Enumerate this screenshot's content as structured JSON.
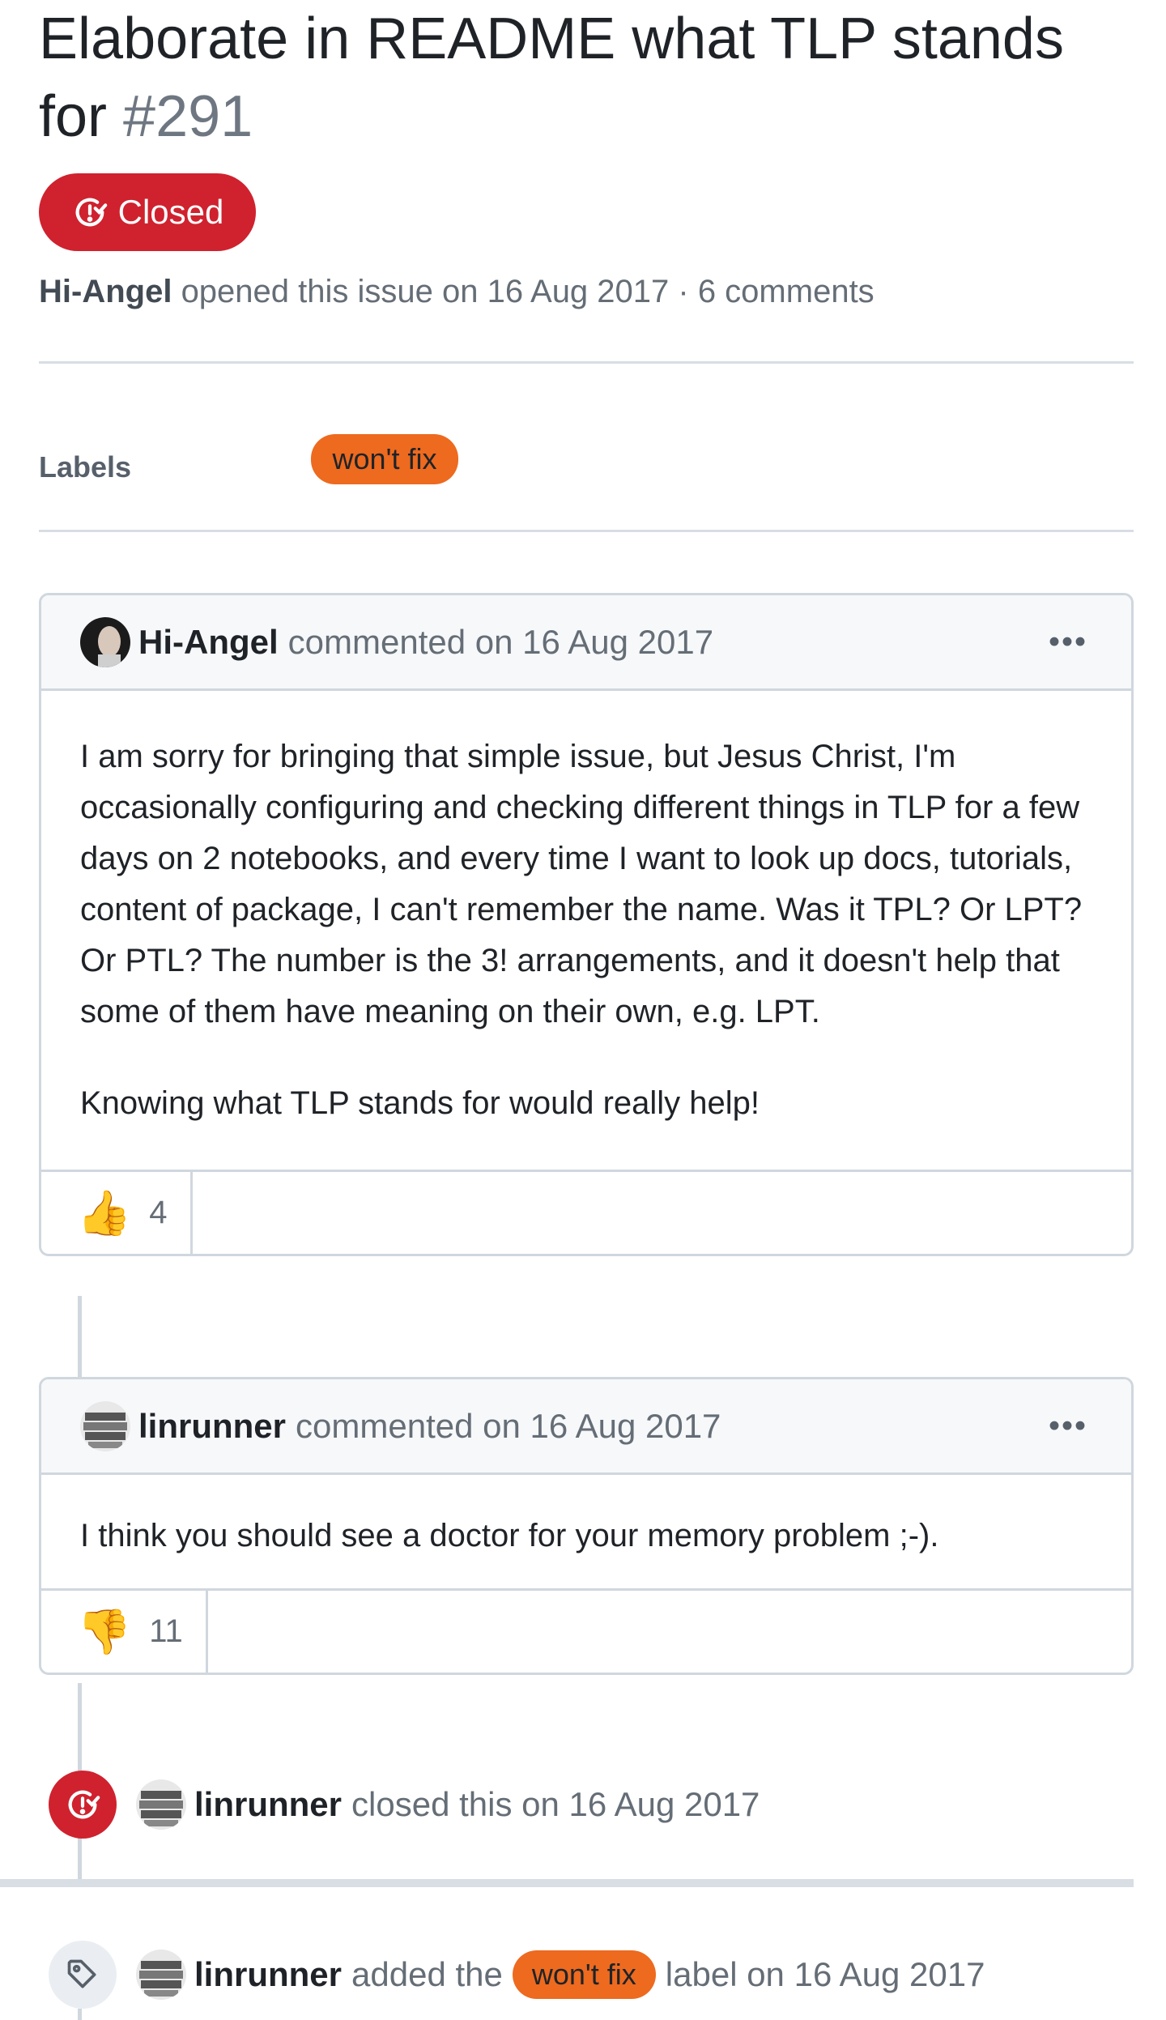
{
  "issue": {
    "title": "Elaborate in README what TLP stands for",
    "number": "#291",
    "state": "Closed",
    "author": "Hi-Angel",
    "meta_text": "opened this issue on 16 Aug 2017 · 6 comments"
  },
  "labels": {
    "heading": "Labels",
    "items": [
      "won't fix"
    ]
  },
  "comments": [
    {
      "author": "Hi-Angel",
      "action": "commented on 16 Aug 2017",
      "more": "•••",
      "paragraphs": [
        "I am sorry for bringing that simple issue, but Jesus Christ, I'm occasionally configuring and checking different things in TLP for a few days on 2 notebooks, and every time I want to look up docs, tutorials, content of package, I can't remember the name. Was it TPL? Or LPT? Or PTL? The number is the 3! arrangements, and it doesn't help that some of them have meaning on their own, e.g. LPT.",
        "Knowing what TLP stands for would really help!"
      ],
      "reaction": {
        "emoji": "👍",
        "count": "4"
      }
    },
    {
      "author": "linrunner",
      "action": "commented on 16 Aug 2017",
      "more": "•••",
      "paragraphs": [
        "I think you should see a doctor for your memory problem ;-)."
      ],
      "reaction": {
        "emoji": "👎",
        "count": "11"
      }
    }
  ],
  "events": {
    "closed": {
      "actor": "linrunner",
      "text": "closed this on 16 Aug 2017"
    },
    "labeled": {
      "actor": "linrunner",
      "pre": "added the",
      "label": "won't fix",
      "post": "label on 16 Aug 2017"
    }
  },
  "colors": {
    "closed": "#cf222e",
    "label_wontfix": "#ed6a1f",
    "border": "#d0d7de"
  },
  "icons": [
    "issue-closed-icon",
    "kebab-icon",
    "thumbs-up-icon",
    "thumbs-down-icon",
    "tag-icon"
  ]
}
